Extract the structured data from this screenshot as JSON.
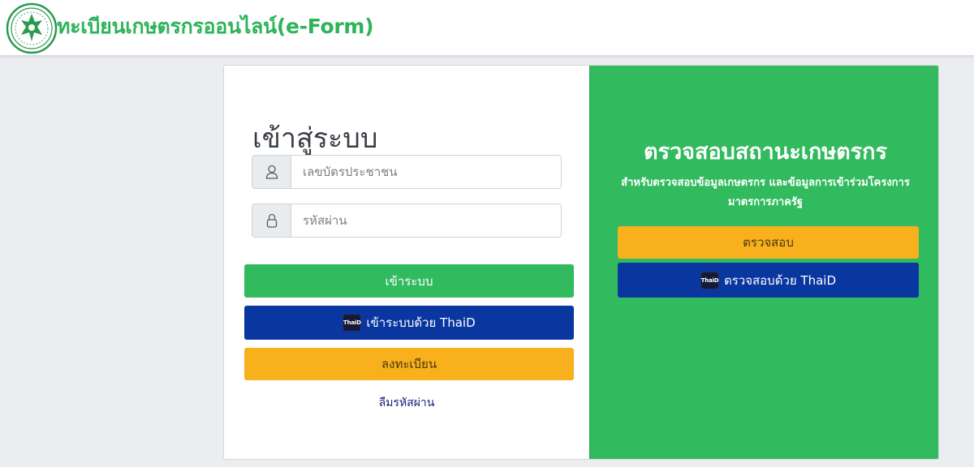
{
  "header": {
    "app_title": "ทะเบียนเกษตรกรออนไลน์(e-Form)"
  },
  "login": {
    "title": "เข้าสู่ระบบ",
    "id_placeholder": "เลขบัตรประชาชน",
    "password_placeholder": "รหัสผ่าน",
    "login_button": "เข้าระบบ",
    "thaid_login_button": "เข้าระบบด้วย ThaiD",
    "register_button": "ลงทะเบียน",
    "forgot_password": "ลืมรหัสผ่าน"
  },
  "check_status": {
    "title": "ตรวจสอบสถานะเกษตรกร",
    "description": "สำหรับตรวจสอบข้อมูลเกษตรกร และข้อมูลการเข้าร่วมโครงการมาตรการภาครัฐ",
    "check_button": "ตรวจสอบ",
    "thaid_check_button": "ตรวจสอบด้วย ThaiD"
  },
  "thaid_badge_text": "ThaiD",
  "icons": {
    "logo": "ministry-emblem-icon",
    "user": "user-icon",
    "lock": "lock-icon",
    "thaid": "thaid-icon"
  },
  "colors": {
    "brand_green": "#31ba5e",
    "thaid_blue": "#0a36a0",
    "register_yellow": "#f8b01c",
    "background": "#ebedf0"
  }
}
